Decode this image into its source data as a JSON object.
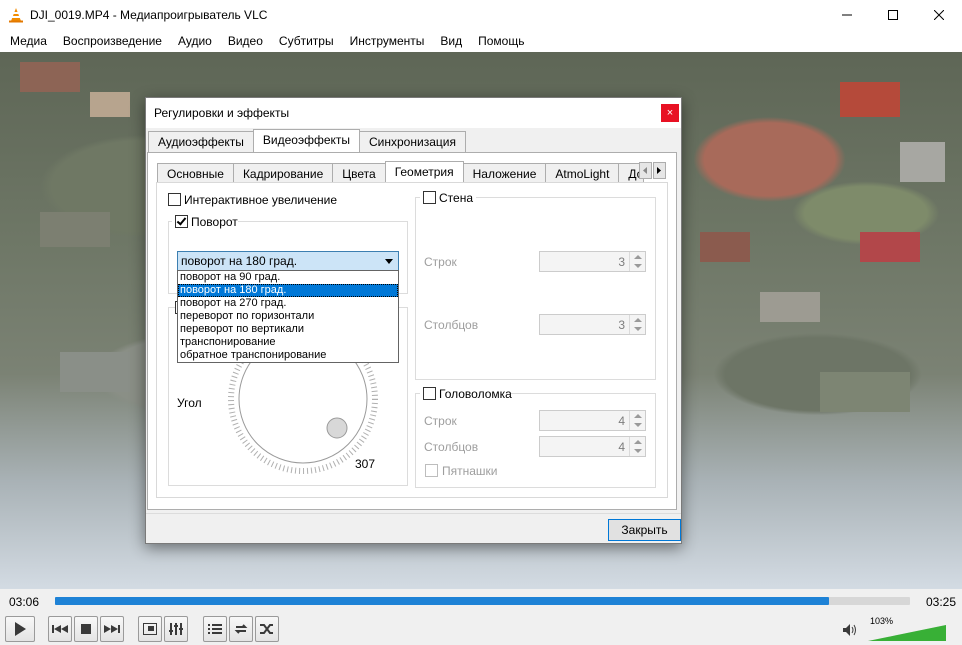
{
  "window": {
    "title": "DJI_0019.MP4 - Медиапроигрыватель VLC"
  },
  "menu": [
    "Медиа",
    "Воспроизведение",
    "Аудио",
    "Видео",
    "Субтитры",
    "Инструменты",
    "Вид",
    "Помощь"
  ],
  "player": {
    "elapsed": "03:06",
    "total": "03:25",
    "progress_fraction": 0.905,
    "volume_label": "103%",
    "volume_fraction": 1.0
  },
  "dialog": {
    "title": "Регулировки и эффекты",
    "top_tabs": [
      "Аудиоэффекты",
      "Видеоэффекты",
      "Синхронизация"
    ],
    "top_selected": 1,
    "sub_tabs": [
      "Основные",
      "Кадрирование",
      "Цвета",
      "Геометрия",
      "Наложение",
      "AtmoLight",
      "До"
    ],
    "sub_selected": 3,
    "interactive_zoom_label": "Интерактивное увеличение",
    "interactive_zoom_checked": false,
    "rotate_label": "Поворот",
    "rotate_checked": true,
    "rotate_selected": "поворот на 180 град.",
    "rotate_options": [
      "поворот на 90 град.",
      "поворот на 180 град.",
      "поворот на 270 град.",
      "переворот по горизонтали",
      "переворот по вертикали",
      "транспонирование",
      "обратное транспонирование"
    ],
    "rotate_selected_index": 1,
    "angle_label": "Угол",
    "angle_value": "307",
    "wall": {
      "label": "Стена",
      "checked": false,
      "rows_label": "Строк",
      "rows_value": "3",
      "cols_label": "Столбцов",
      "cols_value": "3"
    },
    "puzzle": {
      "label": "Головоломка",
      "checked": false,
      "rows_label": "Строк",
      "rows_value": "4",
      "cols_label": "Столбцов",
      "cols_value": "4",
      "game_label": "Пятнашки",
      "game_checked": false
    },
    "close_label": "Закрыть",
    "close_icon_glyph": "×"
  }
}
